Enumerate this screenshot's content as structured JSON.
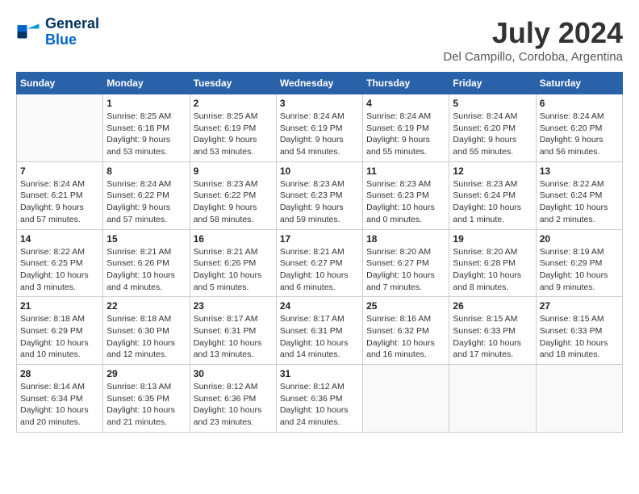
{
  "logo": {
    "line1": "General",
    "line2": "Blue"
  },
  "title": "July 2024",
  "location": "Del Campillo, Cordoba, Argentina",
  "weekdays": [
    "Sunday",
    "Monday",
    "Tuesday",
    "Wednesday",
    "Thursday",
    "Friday",
    "Saturday"
  ],
  "weeks": [
    [
      {
        "day": "",
        "info": ""
      },
      {
        "day": "1",
        "info": "Sunrise: 8:25 AM\nSunset: 6:18 PM\nDaylight: 9 hours\nand 53 minutes."
      },
      {
        "day": "2",
        "info": "Sunrise: 8:25 AM\nSunset: 6:19 PM\nDaylight: 9 hours\nand 53 minutes."
      },
      {
        "day": "3",
        "info": "Sunrise: 8:24 AM\nSunset: 6:19 PM\nDaylight: 9 hours\nand 54 minutes."
      },
      {
        "day": "4",
        "info": "Sunrise: 8:24 AM\nSunset: 6:19 PM\nDaylight: 9 hours\nand 55 minutes."
      },
      {
        "day": "5",
        "info": "Sunrise: 8:24 AM\nSunset: 6:20 PM\nDaylight: 9 hours\nand 55 minutes."
      },
      {
        "day": "6",
        "info": "Sunrise: 8:24 AM\nSunset: 6:20 PM\nDaylight: 9 hours\nand 56 minutes."
      }
    ],
    [
      {
        "day": "7",
        "info": "Sunrise: 8:24 AM\nSunset: 6:21 PM\nDaylight: 9 hours\nand 57 minutes."
      },
      {
        "day": "8",
        "info": "Sunrise: 8:24 AM\nSunset: 6:22 PM\nDaylight: 9 hours\nand 57 minutes."
      },
      {
        "day": "9",
        "info": "Sunrise: 8:23 AM\nSunset: 6:22 PM\nDaylight: 9 hours\nand 58 minutes."
      },
      {
        "day": "10",
        "info": "Sunrise: 8:23 AM\nSunset: 6:23 PM\nDaylight: 9 hours\nand 59 minutes."
      },
      {
        "day": "11",
        "info": "Sunrise: 8:23 AM\nSunset: 6:23 PM\nDaylight: 10 hours\nand 0 minutes."
      },
      {
        "day": "12",
        "info": "Sunrise: 8:23 AM\nSunset: 6:24 PM\nDaylight: 10 hours\nand 1 minute."
      },
      {
        "day": "13",
        "info": "Sunrise: 8:22 AM\nSunset: 6:24 PM\nDaylight: 10 hours\nand 2 minutes."
      }
    ],
    [
      {
        "day": "14",
        "info": "Sunrise: 8:22 AM\nSunset: 6:25 PM\nDaylight: 10 hours\nand 3 minutes."
      },
      {
        "day": "15",
        "info": "Sunrise: 8:21 AM\nSunset: 6:26 PM\nDaylight: 10 hours\nand 4 minutes."
      },
      {
        "day": "16",
        "info": "Sunrise: 8:21 AM\nSunset: 6:26 PM\nDaylight: 10 hours\nand 5 minutes."
      },
      {
        "day": "17",
        "info": "Sunrise: 8:21 AM\nSunset: 6:27 PM\nDaylight: 10 hours\nand 6 minutes."
      },
      {
        "day": "18",
        "info": "Sunrise: 8:20 AM\nSunset: 6:27 PM\nDaylight: 10 hours\nand 7 minutes."
      },
      {
        "day": "19",
        "info": "Sunrise: 8:20 AM\nSunset: 6:28 PM\nDaylight: 10 hours\nand 8 minutes."
      },
      {
        "day": "20",
        "info": "Sunrise: 8:19 AM\nSunset: 6:29 PM\nDaylight: 10 hours\nand 9 minutes."
      }
    ],
    [
      {
        "day": "21",
        "info": "Sunrise: 8:18 AM\nSunset: 6:29 PM\nDaylight: 10 hours\nand 10 minutes."
      },
      {
        "day": "22",
        "info": "Sunrise: 8:18 AM\nSunset: 6:30 PM\nDaylight: 10 hours\nand 12 minutes."
      },
      {
        "day": "23",
        "info": "Sunrise: 8:17 AM\nSunset: 6:31 PM\nDaylight: 10 hours\nand 13 minutes."
      },
      {
        "day": "24",
        "info": "Sunrise: 8:17 AM\nSunset: 6:31 PM\nDaylight: 10 hours\nand 14 minutes."
      },
      {
        "day": "25",
        "info": "Sunrise: 8:16 AM\nSunset: 6:32 PM\nDaylight: 10 hours\nand 16 minutes."
      },
      {
        "day": "26",
        "info": "Sunrise: 8:15 AM\nSunset: 6:33 PM\nDaylight: 10 hours\nand 17 minutes."
      },
      {
        "day": "27",
        "info": "Sunrise: 8:15 AM\nSunset: 6:33 PM\nDaylight: 10 hours\nand 18 minutes."
      }
    ],
    [
      {
        "day": "28",
        "info": "Sunrise: 8:14 AM\nSunset: 6:34 PM\nDaylight: 10 hours\nand 20 minutes."
      },
      {
        "day": "29",
        "info": "Sunrise: 8:13 AM\nSunset: 6:35 PM\nDaylight: 10 hours\nand 21 minutes."
      },
      {
        "day": "30",
        "info": "Sunrise: 8:12 AM\nSunset: 6:36 PM\nDaylight: 10 hours\nand 23 minutes."
      },
      {
        "day": "31",
        "info": "Sunrise: 8:12 AM\nSunset: 6:36 PM\nDaylight: 10 hours\nand 24 minutes."
      },
      {
        "day": "",
        "info": ""
      },
      {
        "day": "",
        "info": ""
      },
      {
        "day": "",
        "info": ""
      }
    ]
  ]
}
